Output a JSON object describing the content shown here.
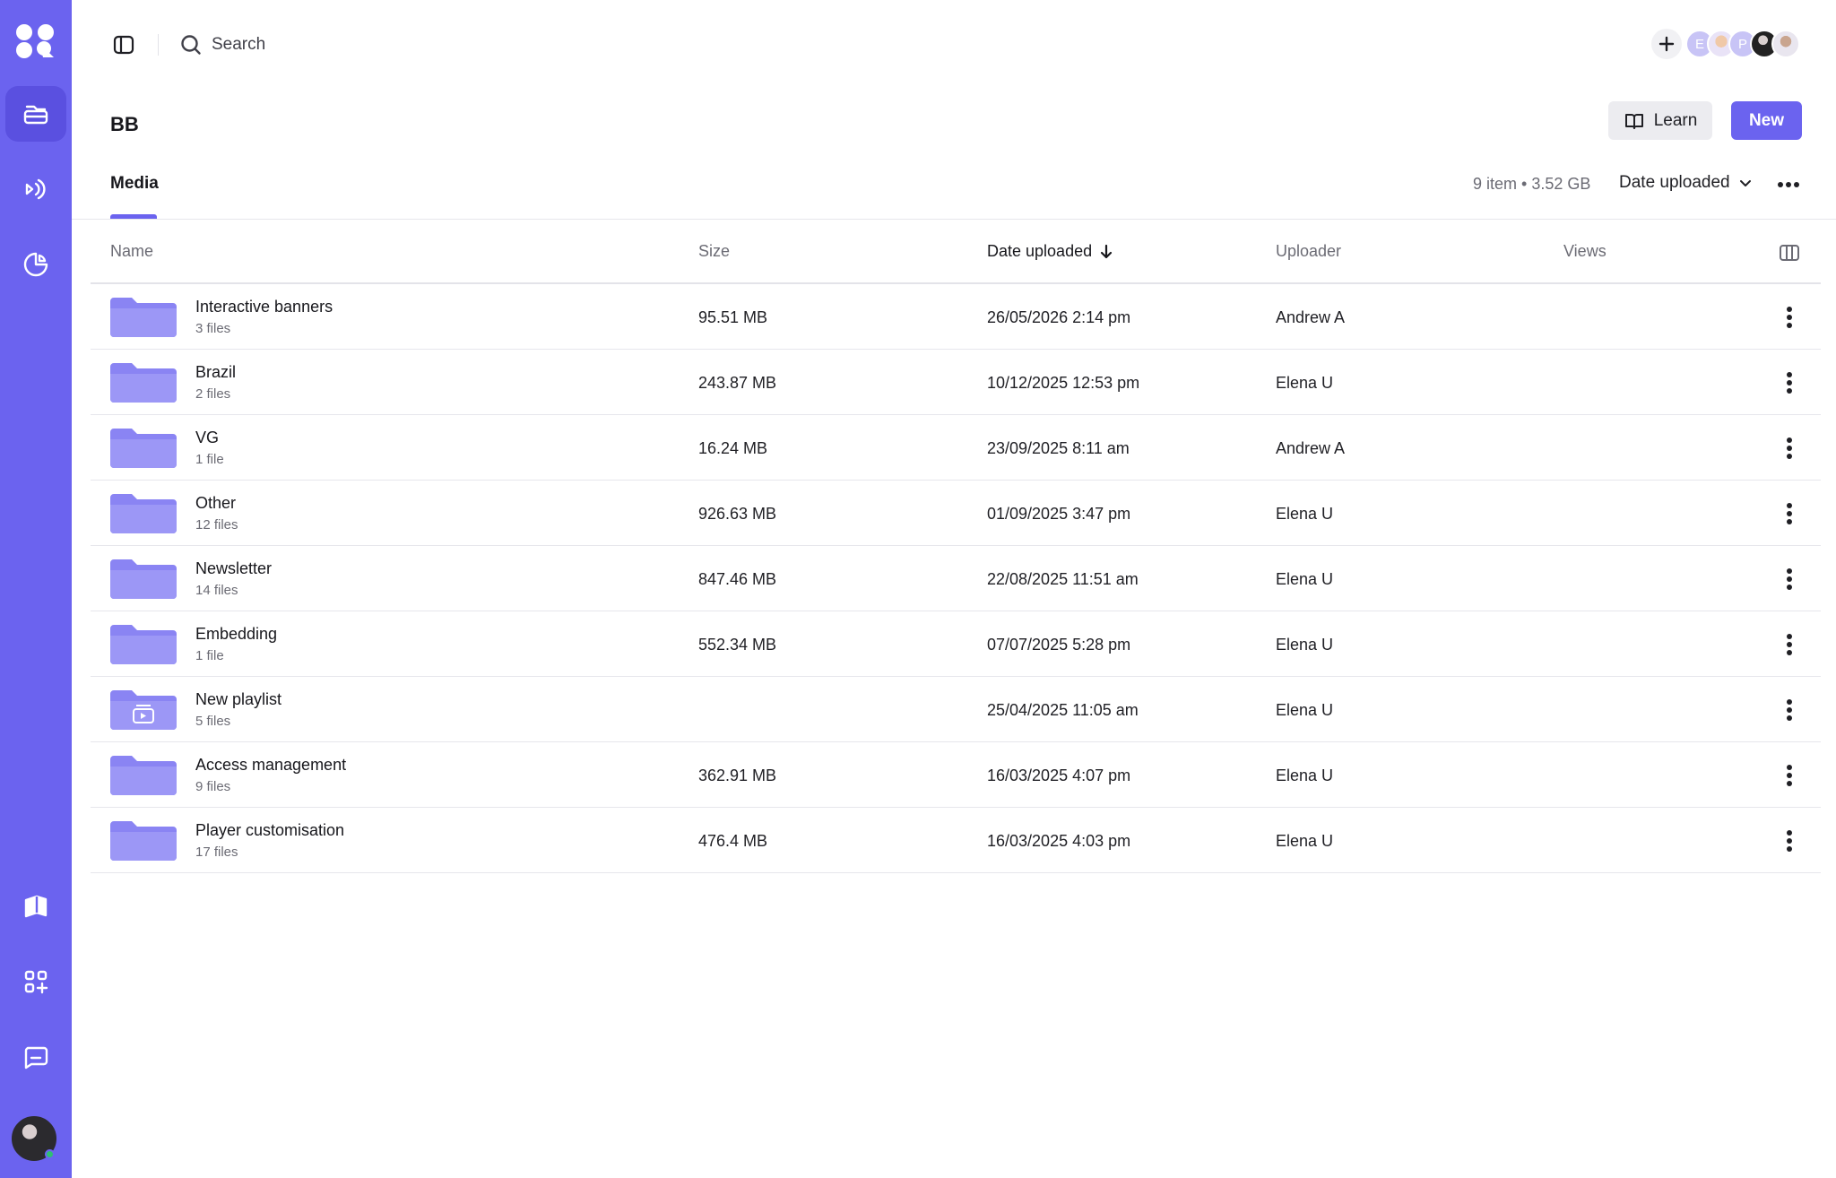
{
  "search": {
    "label": "Search"
  },
  "header": {
    "title": "BB",
    "learn_label": "Learn",
    "new_label": "New"
  },
  "tabs": [
    {
      "label": "Media"
    }
  ],
  "summary": "9 item • 3.52 GB",
  "sort": {
    "selected": "Date uploaded"
  },
  "collaborators": [
    {
      "initial": "E"
    },
    {
      "initial": ""
    },
    {
      "initial": "P"
    },
    {
      "initial": ""
    },
    {
      "initial": ""
    }
  ],
  "columns": {
    "name": "Name",
    "size": "Size",
    "date": "Date uploaded",
    "uploader": "Uploader",
    "views": "Views"
  },
  "rows": [
    {
      "name": "Interactive banners",
      "count": "3 files",
      "size": "95.51 MB",
      "date": "26/05/2026 2:14 pm",
      "uploader": "Andrew A",
      "type": "folder"
    },
    {
      "name": "Brazil",
      "count": "2 files",
      "size": "243.87 MB",
      "date": "10/12/2025 12:53 pm",
      "uploader": "Elena U",
      "type": "folder"
    },
    {
      "name": "VG",
      "count": "1 file",
      "size": "16.24 MB",
      "date": "23/09/2025 8:11 am",
      "uploader": "Andrew A",
      "type": "folder"
    },
    {
      "name": "Other",
      "count": "12 files",
      "size": "926.63 MB",
      "date": "01/09/2025 3:47 pm",
      "uploader": "Elena U",
      "type": "folder"
    },
    {
      "name": "Newsletter",
      "count": "14 files",
      "size": "847.46 MB",
      "date": "22/08/2025 11:51 am",
      "uploader": "Elena U",
      "type": "folder"
    },
    {
      "name": "Embedding",
      "count": "1 file",
      "size": "552.34 MB",
      "date": "07/07/2025 5:28 pm",
      "uploader": "Elena U",
      "type": "folder"
    },
    {
      "name": "New playlist",
      "count": "5 files",
      "size": "",
      "date": "25/04/2025 11:05 am",
      "uploader": "Elena U",
      "type": "playlist"
    },
    {
      "name": "Access management",
      "count": "9 files",
      "size": "362.91 MB",
      "date": "16/03/2025 4:07 pm",
      "uploader": "Elena U",
      "type": "folder"
    },
    {
      "name": "Player customisation",
      "count": "17 files",
      "size": "476.4 MB",
      "date": "16/03/2025 4:03 pm",
      "uploader": "Elena U",
      "type": "folder"
    }
  ],
  "colors": {
    "brand": "#6b63ef",
    "brand_dark": "#5a50e0",
    "folder": "#8a84f3"
  },
  "icons": {
    "sidebar": [
      "logo-icon",
      "media-library-icon",
      "channels-icon",
      "analytics-icon",
      "courses-icon",
      "integrations-icon",
      "chat-icon"
    ],
    "topbar": [
      "sidebar-toggle-icon",
      "search-icon",
      "plus-icon"
    ],
    "header": [
      "book-icon"
    ],
    "table": [
      "sort-down-arrow-icon",
      "columns-icon",
      "kebab-menu-icon",
      "folder-icon",
      "playlist-folder-icon"
    ]
  }
}
